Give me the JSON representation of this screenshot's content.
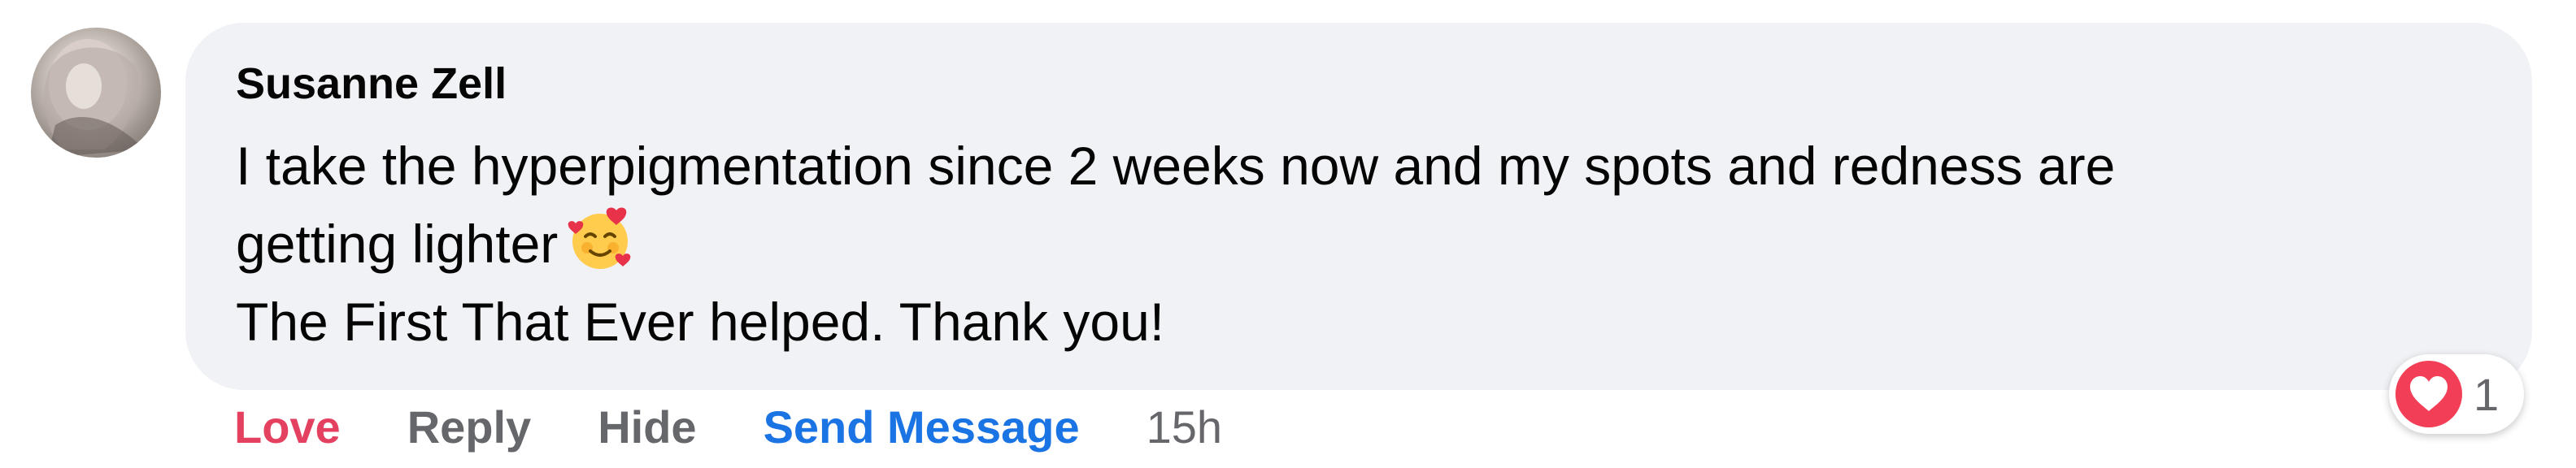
{
  "comment": {
    "author": "Susanne Zell",
    "text_lines": [
      "I take the hyperpigmentation since 2 weeks now and my spots and redness are",
      "getting lighter",
      "The First That Ever helped. Thank you!"
    ],
    "emoji": "smiling-face-with-hearts-icon"
  },
  "actions": {
    "love": "Love",
    "reply": "Reply",
    "hide": "Hide",
    "send_message": "Send Message",
    "timestamp": "15h"
  },
  "reactions": {
    "icon": "heart-icon",
    "count": "1"
  },
  "colors": {
    "bubble": "#f0f2f5",
    "love": "#e4405f",
    "send_message": "#1b74e4",
    "secondary_text": "#65676b",
    "heart": "#f33e58"
  }
}
